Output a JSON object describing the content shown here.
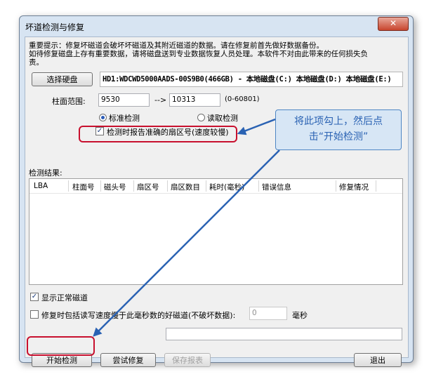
{
  "window": {
    "title": "坏道检测与修复",
    "close_glyph": "✕"
  },
  "notice": {
    "line1": "重要提示：修复坏磁道会破坏坏磁道及其附近磁道的数据。请在修复前首先做好数据备份。",
    "line2": "如待修复磁盘上存有重要数据，请将磁盘送到专业数据恢复人员处理。本软件不对由此带来的任何损失负",
    "line3": "责。"
  },
  "disk": {
    "select_label": "选择硬盘",
    "value": "HD1:WDCWD5000AADS-00S9B0(466GB) - 本地磁盘(C:) 本地磁盘(D:) 本地磁盘(E:)"
  },
  "range": {
    "label": "柱面范围:",
    "start": "9530",
    "arrow": "-->",
    "end": "10313",
    "hint": "(0-60801)"
  },
  "mode": {
    "standard_label": "标准检测",
    "read_label": "读取检测",
    "selected": "standard"
  },
  "accurate_check": {
    "label": "检测时报告准确的扇区号(速度较慢)",
    "checked": true,
    "mark": "✓"
  },
  "results": {
    "label": "检测结果:",
    "columns": [
      "LBA",
      "柱面号",
      "磁头号",
      "扇区号",
      "扇区数目",
      "耗时(毫秒)",
      "错误信息",
      "修复情况"
    ]
  },
  "show_normal": {
    "label": "显示正常磁道",
    "checked": true,
    "mark": "✓"
  },
  "slow_repair": {
    "label": "修复时包括读写速度慢于此毫秒数的好磁道(不破坏数据):",
    "checked": false,
    "value": "0",
    "unit": "毫秒"
  },
  "buttons": {
    "start": "开始检测",
    "try_repair": "尝试修复",
    "save_report": "保存报表",
    "exit": "退出"
  },
  "callout": {
    "line1": "将此项勾上，然后点",
    "line2": "击“开始检测”"
  },
  "colors": {
    "annotation_red": "#c8102e",
    "annotation_blue": "#2a62b3"
  }
}
